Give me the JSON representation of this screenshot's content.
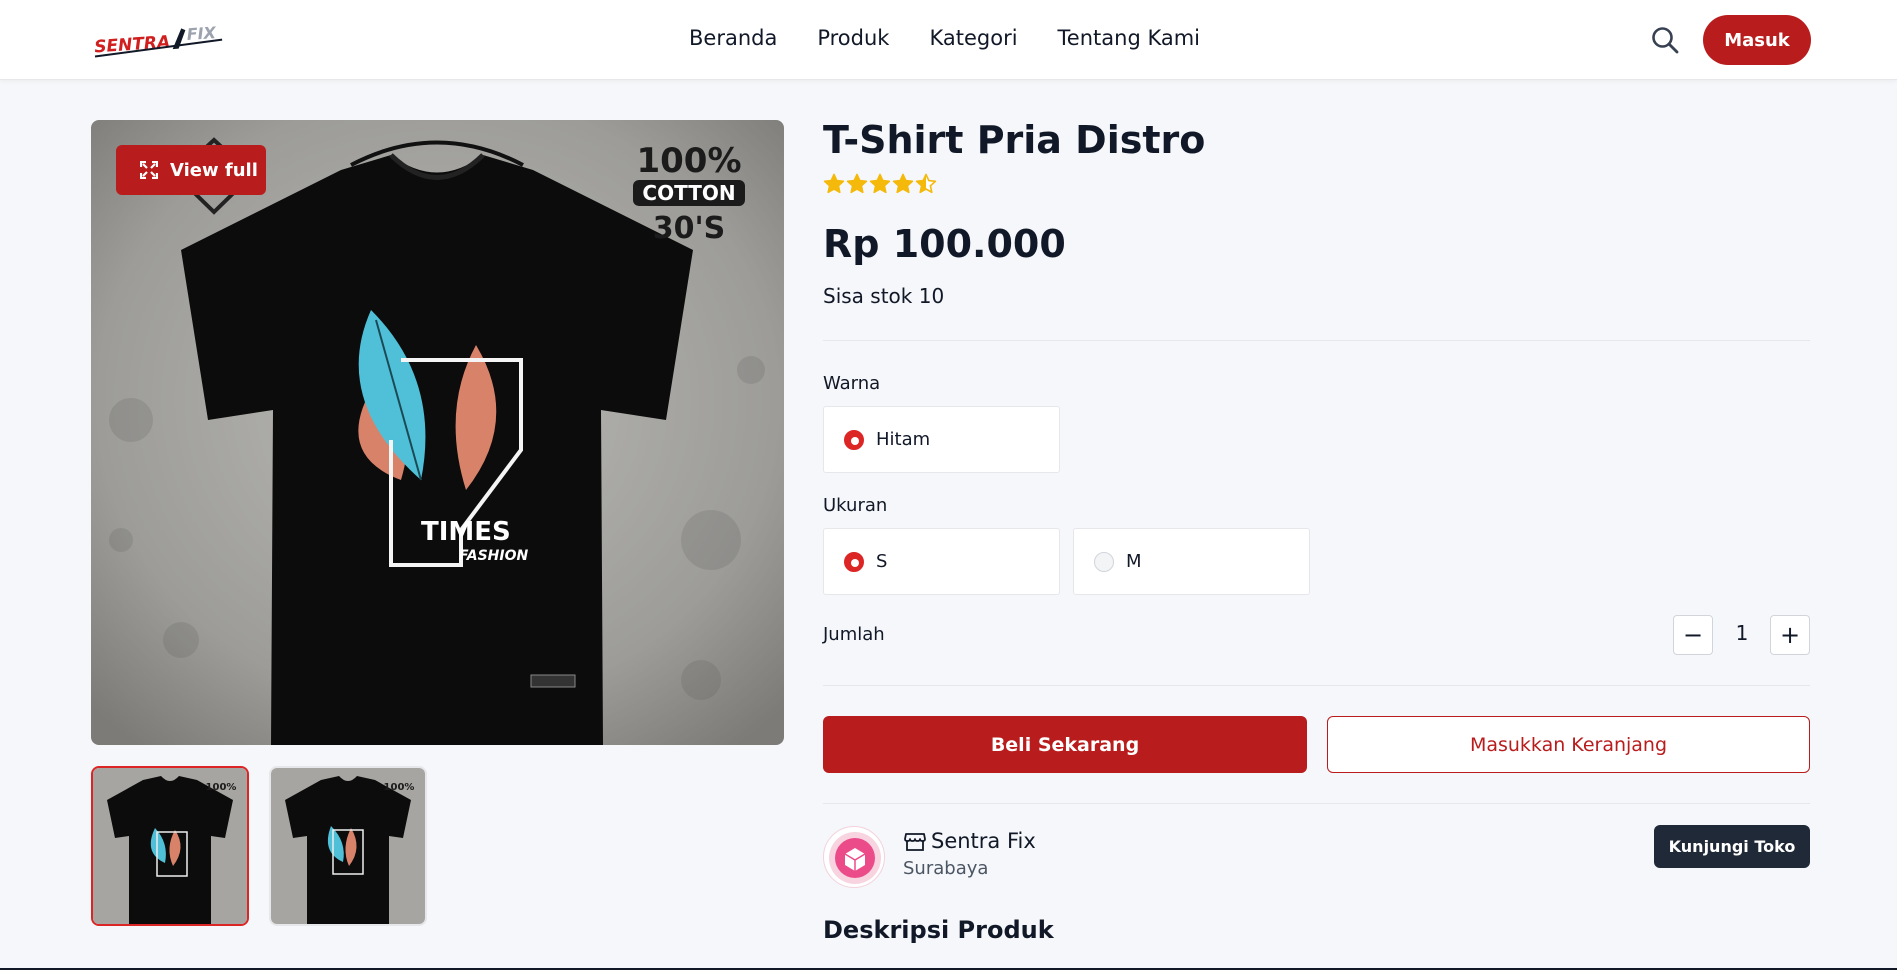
{
  "header": {
    "logo_text": "SENTRA FIX",
    "nav": [
      "Beranda",
      "Produk",
      "Kategori",
      "Tentang Kami"
    ],
    "login_label": "Masuk"
  },
  "gallery": {
    "view_full_label": "View full",
    "print_badge": [
      "100%",
      "COTTON",
      "30'S"
    ],
    "shirt_print": [
      "TIMES",
      "FASHION"
    ]
  },
  "product": {
    "title": "T-Shirt Pria Distro",
    "rating": 4.5,
    "price": "Rp 100.000",
    "stock": "Sisa stok 10"
  },
  "options": {
    "color_label": "Warna",
    "colors": [
      {
        "label": "Hitam",
        "selected": true
      }
    ],
    "size_label": "Ukuran",
    "sizes": [
      {
        "label": "S",
        "selected": true
      },
      {
        "label": "M",
        "selected": false
      }
    ]
  },
  "quantity": {
    "label": "Jumlah",
    "minus": "−",
    "value": "1",
    "plus": "+"
  },
  "actions": {
    "buy_label": "Beli Sekarang",
    "cart_label": "Masukkan Keranjang"
  },
  "shop": {
    "name": "Sentra Fix",
    "city": "Surabaya",
    "visit_label": "Kunjungi Toko"
  },
  "description": {
    "title": "Deskripsi Produk"
  },
  "colors": {
    "brand": "#b91c1c",
    "star": "#f5b90b",
    "dark": "#1f2937"
  }
}
